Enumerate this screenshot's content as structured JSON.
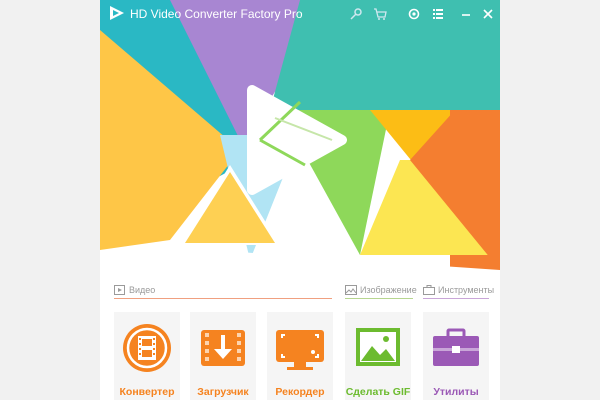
{
  "app": {
    "title": "HD Video Converter Factory Pro"
  },
  "titlebar": {
    "icons": [
      "key-icon",
      "cart-icon",
      "gear-icon",
      "menu-list-icon",
      "minimize-icon",
      "close-icon"
    ]
  },
  "sections": {
    "video": "Видео",
    "image": "Изображение",
    "tools": "Инструменты"
  },
  "tiles": [
    {
      "label": "Конвертер",
      "color": "#f58320",
      "icon": "film-icon"
    },
    {
      "label": "Загрузчик",
      "color": "#f58320",
      "icon": "download-icon"
    },
    {
      "label": "Рекордер",
      "color": "#f58320",
      "icon": "screen-record-icon"
    },
    {
      "label": "Сделать GIF",
      "color": "#6cbb2f",
      "icon": "image-icon"
    },
    {
      "label": "Утилиты",
      "color": "#9b59b6",
      "icon": "toolbox-icon"
    }
  ],
  "colors": {
    "video_accent": "#f0a080",
    "image_accent": "#b7d68f",
    "tools_accent": "#c9a6d8"
  }
}
